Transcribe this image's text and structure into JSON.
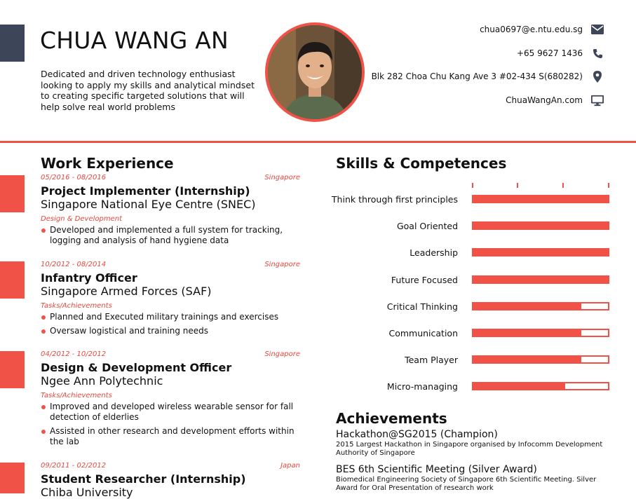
{
  "header": {
    "name": "CHUA WANG AN",
    "summary": "Dedicated and driven technology enthusiast looking to apply my skills and analytical mindset to creating specific targeted solutions that will help solve real world problems"
  },
  "contact": {
    "email": "chua0697@e.ntu.edu.sg",
    "phone": "+65 9627 1436",
    "address": "Blk 282 Choa Chu Kang Ave 3 #02-434 S(680282)",
    "website": "ChuaWangAn.com",
    "icons": [
      "envelope-icon",
      "phone-icon",
      "map-marker-icon",
      "monitor-icon"
    ]
  },
  "work": {
    "title": "Work Experience",
    "jobs": [
      {
        "dates": "05/2016 - 08/2016",
        "location": "Singapore",
        "title": "Project Implementer (Internship)",
        "org": "Singapore National Eye Centre (SNEC)",
        "category": "Design & Development",
        "bullets": [
          "Developed and implemented a full system for tracking, logging and analysis of hand hygiene data"
        ]
      },
      {
        "dates": "10/2012 - 08/2014",
        "location": "Singapore",
        "title": "Infantry Officer",
        "org": "Singapore Armed Forces (SAF)",
        "category": "Tasks/Achievements",
        "bullets": [
          "Planned and Executed military trainings and exercises",
          "Oversaw logistical and training needs"
        ]
      },
      {
        "dates": "04/2012 - 10/2012",
        "location": "Singapore",
        "title": "Design & Development Officer",
        "org": "Ngee Ann Polytechnic",
        "category": "Tasks/Achievements",
        "bullets": [
          "Improved and developed wireless wearable sensor for fall detection of elderlies",
          "Assisted in other research and development efforts within the lab"
        ]
      },
      {
        "dates": "09/2011 - 02/2012",
        "location": "Japan",
        "title": "Student Researcher (Internship)",
        "org": "Chiba University"
      }
    ]
  },
  "skills": {
    "title": "Skills & Competences",
    "items": [
      {
        "label": "Think through first principles",
        "level": 1.0
      },
      {
        "label": "Goal Oriented",
        "level": 1.0
      },
      {
        "label": "Leadership",
        "level": 1.0
      },
      {
        "label": "Future Focused",
        "level": 1.0
      },
      {
        "label": "Critical Thinking",
        "level": 0.8
      },
      {
        "label": "Communication",
        "level": 0.8
      },
      {
        "label": "Team Player",
        "level": 0.8
      },
      {
        "label": "Micro-managing",
        "level": 0.68
      }
    ]
  },
  "achievements": {
    "title": "Achievements",
    "items": [
      {
        "title": "Hackathon@SG2015 (Champion)",
        "desc": "2015 Largest Hackathon in Singapore organised by Infocomm Development Authority of Singapore"
      },
      {
        "title": "BES 6th Scientific Meeting (Silver Award)",
        "desc": "Biomedical Engineering Society of Singapore 6th Scientific Meeting. Silver Award for Oral Presentation of research work"
      }
    ]
  },
  "colors": {
    "accent": "#f05247",
    "header_block": "#3d4558"
  }
}
